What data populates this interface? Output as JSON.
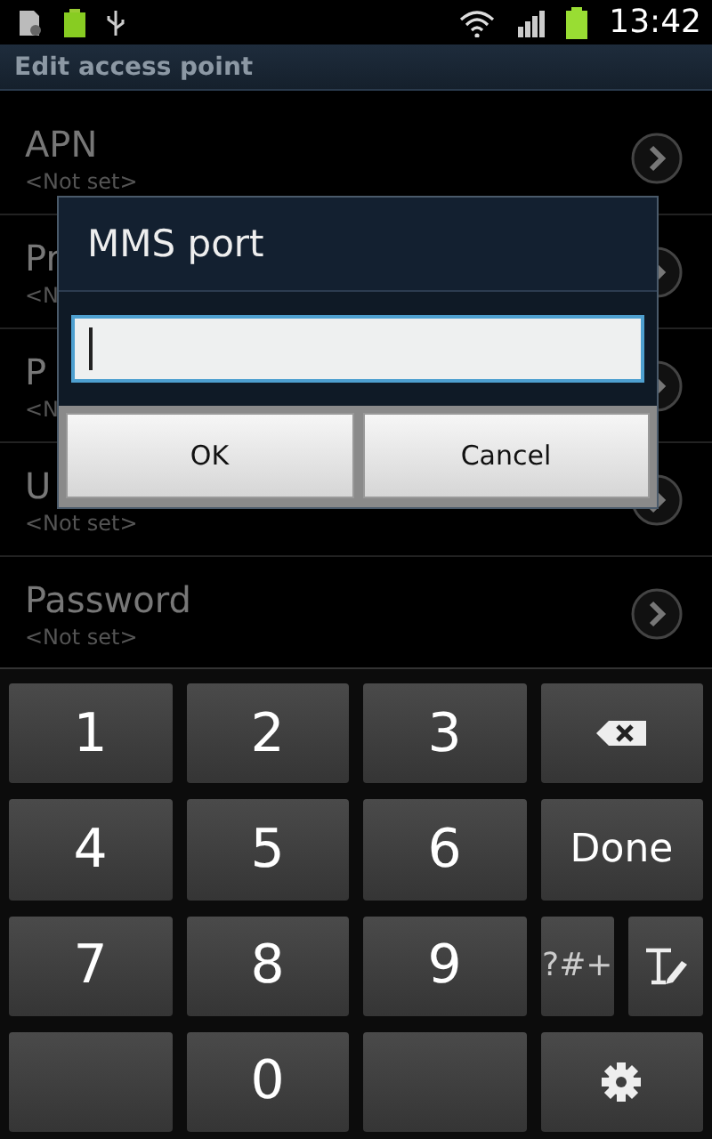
{
  "status_bar": {
    "time": "13:42"
  },
  "header": {
    "title": "Edit access point"
  },
  "settings": [
    {
      "title": "APN",
      "value": "<Not set>"
    },
    {
      "title": "Pr",
      "value": "<N"
    },
    {
      "title": "P",
      "value": "<N"
    },
    {
      "title": "U",
      "value": "<Not set>"
    },
    {
      "title": "Password",
      "value": "<Not set>"
    }
  ],
  "dialog": {
    "title": "MMS port",
    "buttons": [
      "OK",
      "Cancel"
    ]
  },
  "keyboard": [
    [
      {
        "kind": "digit",
        "label": "1"
      },
      {
        "kind": "digit",
        "label": "2"
      },
      {
        "kind": "digit",
        "label": "3"
      },
      {
        "kind": "backspace"
      }
    ],
    [
      {
        "kind": "digit",
        "label": "4"
      },
      {
        "kind": "digit",
        "label": "5"
      },
      {
        "kind": "digit",
        "label": "6"
      },
      {
        "kind": "action",
        "label": "Done"
      }
    ],
    [
      {
        "kind": "digit",
        "label": "7"
      },
      {
        "kind": "digit",
        "label": "8"
      },
      {
        "kind": "digit",
        "label": "9"
      },
      {
        "kind": "split",
        "label": "?#+"
      }
    ],
    [
      {
        "kind": "blank"
      },
      {
        "kind": "digit",
        "label": "0"
      },
      {
        "kind": "blank"
      },
      {
        "kind": "settings"
      }
    ]
  ]
}
